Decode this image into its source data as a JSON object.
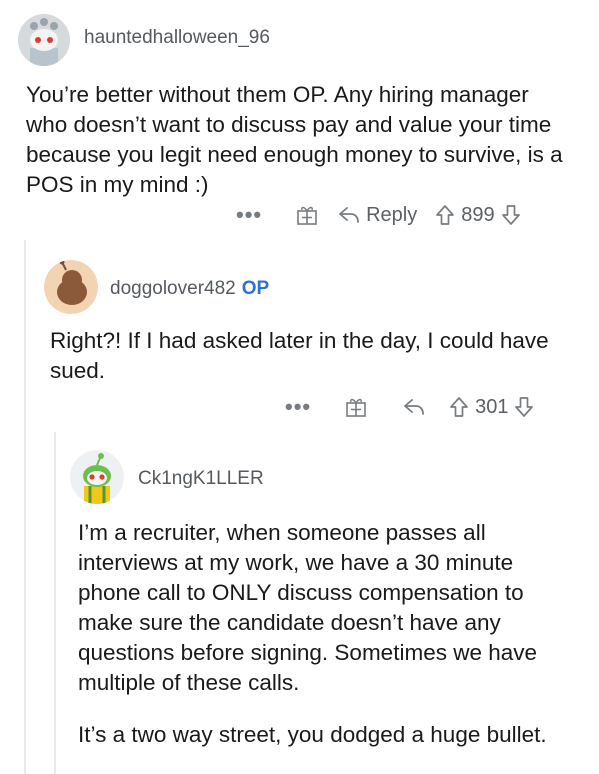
{
  "comments": [
    {
      "username": "hauntedhalloween_96",
      "op_badge": "",
      "body": [
        "You’re better without them OP. Any hiring manager who doesn’t want to discuss pay and value your time because you legit need enough money to survive, is a POS in my mind :)"
      ],
      "actions": {
        "more": "•••",
        "reply_label": "Reply",
        "score": "899"
      },
      "icons": [
        "more-icon",
        "gift-icon",
        "reply-icon",
        "upvote-icon",
        "downvote-icon"
      ]
    },
    {
      "username": "doggolover482",
      "op_badge": "OP",
      "body": [
        "Right?! If I had asked later in the day, I could have sued."
      ],
      "actions": {
        "more": "•••",
        "reply_label": "",
        "score": "301"
      },
      "icons": [
        "more-icon",
        "gift-icon",
        "reply-icon",
        "upvote-icon",
        "downvote-icon"
      ]
    },
    {
      "username": "Ck1ngK1LLER",
      "op_badge": "",
      "body": [
        "I’m a recruiter, when someone passes all interviews at my work, we have a 30 minute phone call to ONLY discuss compensation to make sure the candidate doesn’t have any questions before signing. Sometimes we have multiple of these calls.",
        "It’s a two way street, you dodged a huge bullet."
      ]
    }
  ],
  "colors": {
    "op": "#2f6fd6",
    "meta": "#555a5e",
    "text": "#1a1a1b",
    "thread_line": "#e8e8e8"
  }
}
